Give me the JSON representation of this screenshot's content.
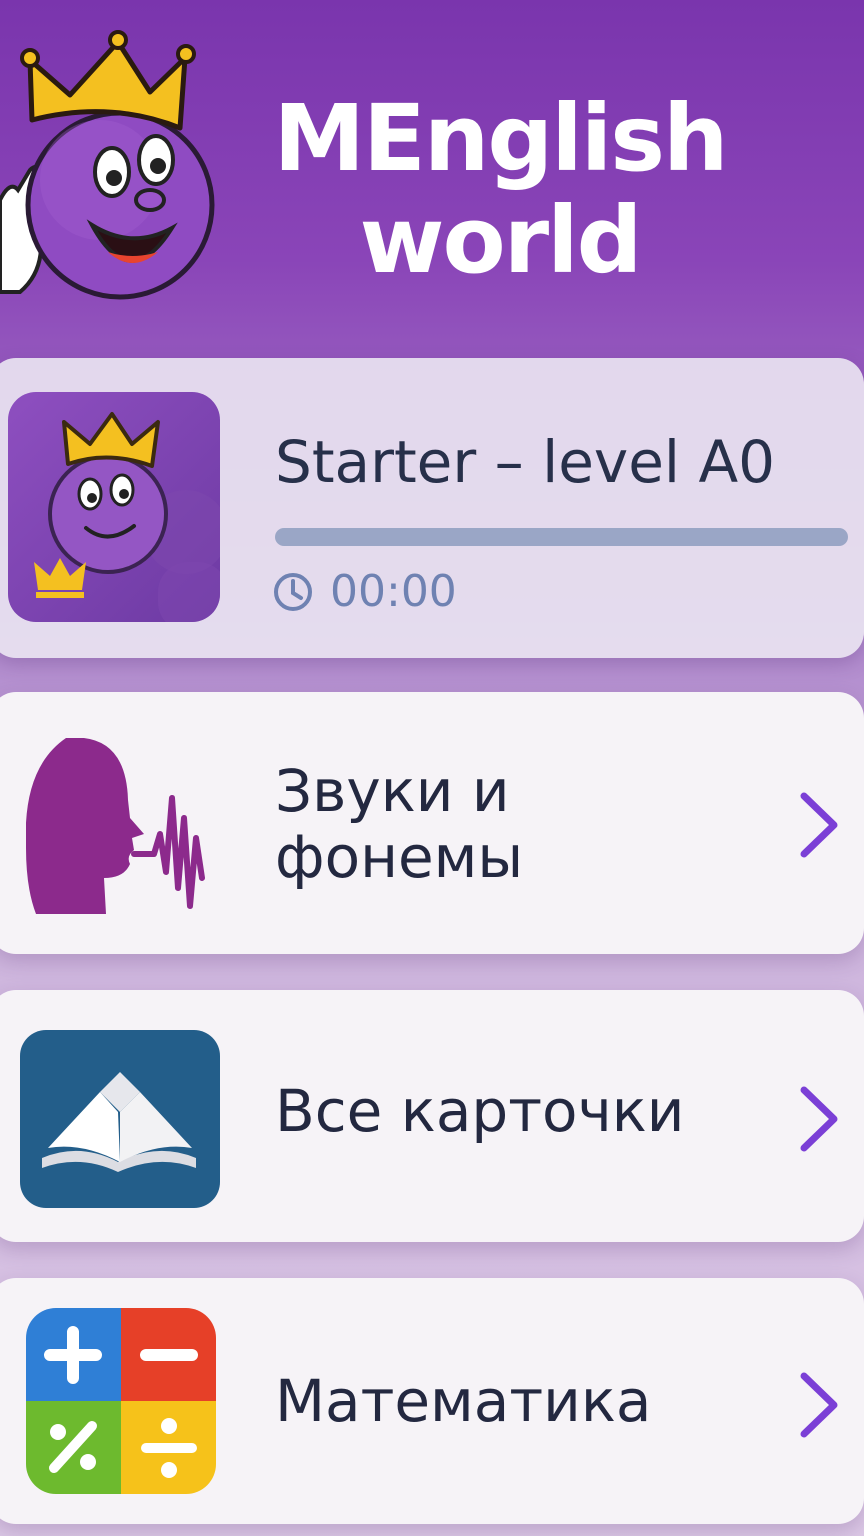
{
  "header": {
    "title_line1": "MEnglish",
    "title_line2": "world"
  },
  "level": {
    "title": "Starter – level A0",
    "progress": 0,
    "time": "00:00"
  },
  "menu": [
    {
      "label": "Звуки и фонемы",
      "icon": "speaking-head-icon"
    },
    {
      "label": "Все карточки",
      "icon": "book-icon"
    },
    {
      "label": "Математика",
      "icon": "math-operations-icon"
    }
  ],
  "colors": {
    "accent": "#7a35ad",
    "chevron": "#7b3fd6",
    "progress_track": "#9aa6c6"
  }
}
